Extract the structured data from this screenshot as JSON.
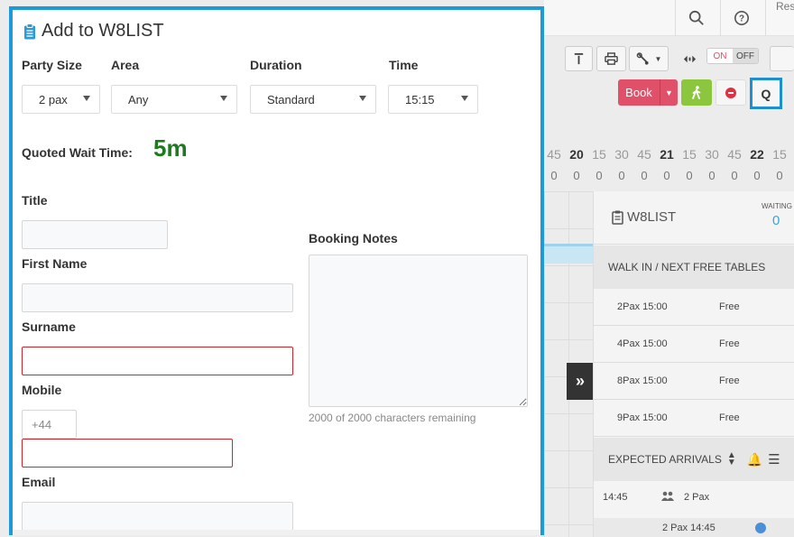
{
  "background": {
    "top_bar": {
      "search_icon": "search-icon",
      "help_icon": "help-icon",
      "truncated_label": "Res"
    },
    "toolbar": {
      "toggle_on": "ON",
      "toggle_off": "OFF"
    },
    "book_button": "Book",
    "q_button": "Q",
    "timeline": {
      "ticks": [
        "45",
        "20",
        "15",
        "30",
        "45",
        "21",
        "15",
        "30",
        "45",
        "22",
        "15"
      ],
      "counts": [
        "0",
        "0",
        "0",
        "0",
        "0",
        "0",
        "0",
        "0",
        "0",
        "0",
        "0"
      ]
    },
    "side_panel": {
      "title": "W8LIST",
      "waiting_label": "WAITING",
      "waiting_count": "0",
      "walk_in_header": "WALK IN / NEXT FREE TABLES",
      "walk_in_rows": [
        {
          "pax": "2Pax  15:00",
          "status": "Free"
        },
        {
          "pax": "4Pax  15:00",
          "status": "Free"
        },
        {
          "pax": "8Pax  15:00",
          "status": "Free"
        },
        {
          "pax": "9Pax  15:00",
          "status": "Free"
        }
      ],
      "arrivals_header": "EXPECTED ARRIVALS",
      "arrival_time": "14:45",
      "arrival_pax": "2 Pax",
      "arrival_partial": "2 Pax  14:45"
    }
  },
  "modal": {
    "title": "Add to W8LIST",
    "party_size": {
      "label": "Party Size",
      "value": "2 pax"
    },
    "area": {
      "label": "Area",
      "value": "Any"
    },
    "duration": {
      "label": "Duration",
      "value": "Standard"
    },
    "time": {
      "label": "Time",
      "value": "15:15"
    },
    "quoted_wait": {
      "label": "Quoted Wait Time:",
      "value": "5m"
    },
    "title_field": {
      "label": "Title",
      "value": ""
    },
    "first_name": {
      "label": "First Name",
      "value": ""
    },
    "surname": {
      "label": "Surname",
      "value": ""
    },
    "mobile": {
      "label": "Mobile",
      "prefix": "+44",
      "value": ""
    },
    "email": {
      "label": "Email",
      "value": ""
    },
    "booking_notes": {
      "label": "Booking Notes",
      "value": "",
      "hint": "2000 of 2000 characters remaining"
    }
  }
}
